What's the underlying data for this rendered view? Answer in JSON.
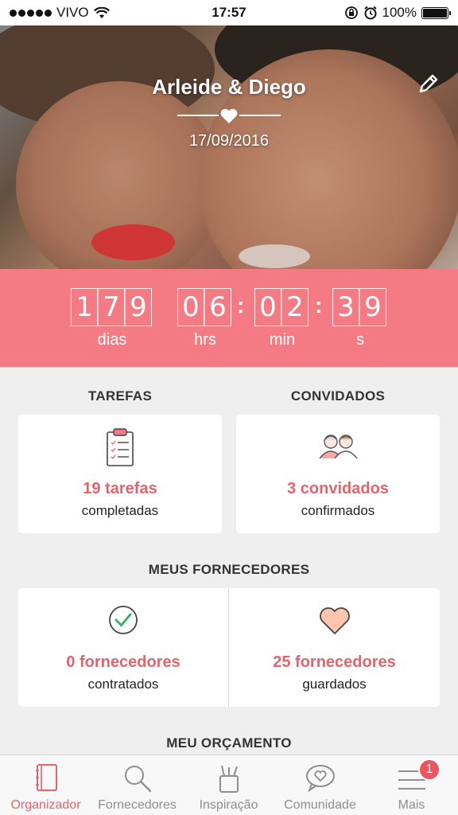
{
  "status_bar": {
    "carrier": "VIVO",
    "time": "17:57",
    "battery": "100%"
  },
  "hero": {
    "couple_name": "Arleide & Diego",
    "date": "17/09/2016"
  },
  "countdown": {
    "days": [
      "1",
      "7",
      "9"
    ],
    "hours": [
      "0",
      "6"
    ],
    "minutes": [
      "0",
      "2"
    ],
    "seconds": [
      "3",
      "9"
    ],
    "labels": {
      "days": "dias",
      "hours": "hrs",
      "minutes": "min",
      "seconds": "s"
    }
  },
  "tasks": {
    "title": "TAREFAS",
    "count": "19 tarefas",
    "sub": "completadas"
  },
  "guests": {
    "title": "CONVIDADOS",
    "count": "3 convidados",
    "sub": "confirmados"
  },
  "vendors": {
    "title": "MEUS FORNECEDORES",
    "hired": {
      "count": "0 fornecedores",
      "sub": "contratados"
    },
    "saved": {
      "count": "25 fornecedores",
      "sub": "guardados"
    }
  },
  "budget": {
    "title": "MEU ORÇAMENTO"
  },
  "tabbar": {
    "items": [
      {
        "label": "Organizador",
        "icon": "notebook-icon"
      },
      {
        "label": "Fornecedores",
        "icon": "search-icon"
      },
      {
        "label": "Inspiração",
        "icon": "inspiration-icon"
      },
      {
        "label": "Comunidade",
        "icon": "chat-heart-icon"
      },
      {
        "label": "Mais",
        "icon": "menu-icon"
      }
    ],
    "badge": "1"
  },
  "colors": {
    "accent": "#f47b84",
    "accent_text": "#e0656c",
    "background": "#efefef"
  }
}
